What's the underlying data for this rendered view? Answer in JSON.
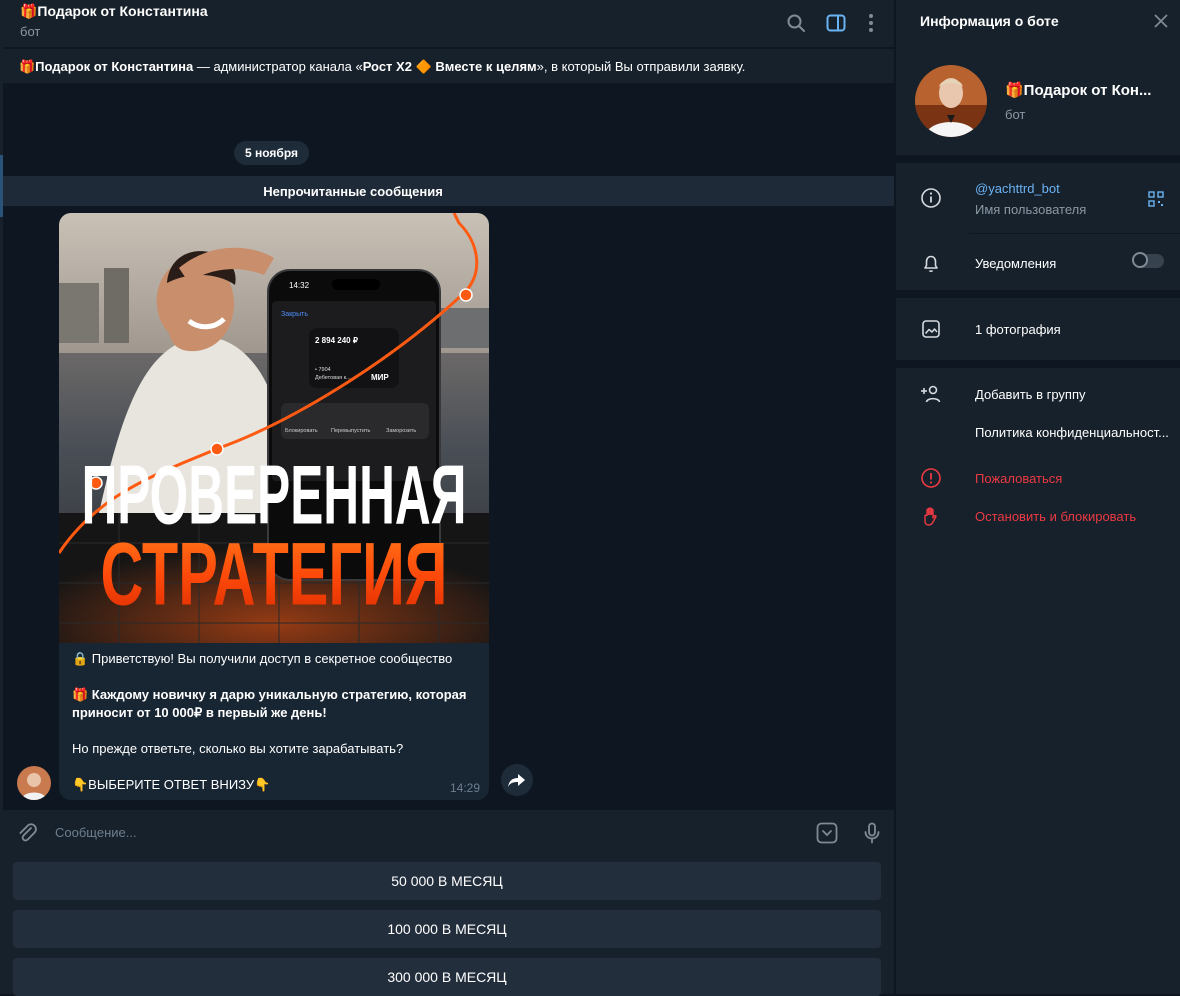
{
  "chat": {
    "title": "🎁Подарок от Константина",
    "subtitle": "бот"
  },
  "notice": {
    "name": "🎁Подарок от Константина",
    "middle": " — администратор канала «",
    "channel": "Рост Х2 🔶 Вместе к целям",
    "end": "», в который Вы отправили заявку."
  },
  "date_label": "5 ноября",
  "unread_label": "Непрочитанные сообщения",
  "message": {
    "image_title_line1": "ПРОВЕРЕННАЯ",
    "image_title_line2": "СТРАТЕГИЯ",
    "phone": {
      "time": "14:32",
      "close": "Закрыть",
      "amount": "2 894 240 ₽",
      "card_digits": "• 7904",
      "card_type": "Дебетовая к...",
      "brand": "МИР",
      "action1": "Блокировать",
      "action2": "Перевыпустить",
      "action3": "Заморозить"
    },
    "line1": "🔒 Приветствую! Вы получили доступ в секретное сообщество",
    "line2": "🎁 Каждому новичку я дарю уникальную стратегию, которая приносит от 10 000₽ в первый же день!",
    "line3": "Но прежде ответьте, сколько вы хотите зарабатывать?",
    "line4": "👇ВЫБЕРИТЕ ОТВЕТ ВНИЗУ👇",
    "time": "14:29"
  },
  "input": {
    "placeholder": "Сообщение..."
  },
  "keyboard": {
    "buttons": [
      "50 000 В МЕСЯЦ",
      "100 000 В МЕСЯЦ",
      "300 000 В МЕСЯЦ"
    ]
  },
  "panel": {
    "title": "Информация о боте",
    "name": "🎁Подарок от Кон...",
    "subtitle": "бот",
    "username": "@yachttrd_bot",
    "username_label": "Имя пользователя",
    "notifications": "Уведомления",
    "photos": "1 фотография",
    "add_to_group": "Добавить в группу",
    "privacy": "Политика конфиденциальност...",
    "report": "Пожаловаться",
    "block": "Остановить и блокировать"
  },
  "colors": {
    "background": "#0e1621",
    "panel": "#17212b",
    "bubble": "#182533",
    "accent": "#6ab3f3",
    "danger": "#ec3942",
    "orange": "#ff5a12"
  },
  "icons": [
    "search-icon",
    "sidebar-toggle-icon",
    "more-icon",
    "attach-icon",
    "bot-keyboard-icon",
    "mic-icon",
    "forward-icon",
    "close-icon",
    "info-icon",
    "qr-icon",
    "bell-icon",
    "image-icon",
    "add-user-icon",
    "warning-icon",
    "hand-icon"
  ]
}
